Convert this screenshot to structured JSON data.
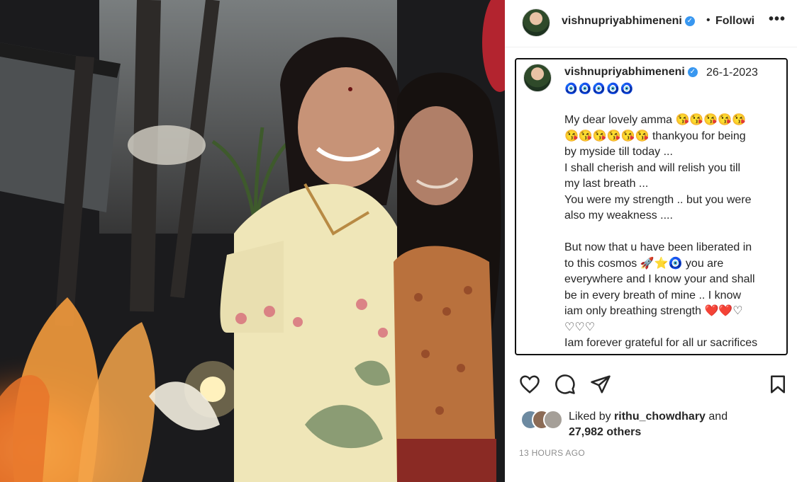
{
  "header": {
    "username": "vishnupriyabhimeneni",
    "separator": "•",
    "follow_label": "Followi",
    "more_label": "•••"
  },
  "caption": {
    "username": "vishnupriyabhimeneni",
    "date": "26-1-2023",
    "emoji_row": "🧿🧿🧿🧿🧿",
    "text": "My dear lovely amma 😘😘😘😘😘\n😘😘😘😘😘😘 thankyou for being\nby myside till today ...\nI shall cherish and will relish you till\nmy last breath ...\nYou were my strength .. but you were\nalso my weakness ....\n\nBut now that u have been liberated in\nto this cosmos 🚀⭐🧿 you are\neverywhere and I know your and shall\nbe in every breath of mine .. I know\niam only breathing strength ❤️❤️♡\n♡♡♡\nIam forever grateful for all ur sacrifices\nand I want you in my next possible"
  },
  "actions": {
    "like_icon": "heart-icon",
    "comment_icon": "comment-icon",
    "share_icon": "share-icon",
    "save_icon": "bookmark-icon"
  },
  "likes": {
    "prefix": "Liked by ",
    "liker_name": "rithu_chowdhary",
    "middle": " and",
    "count": "27,982 others"
  },
  "timestamp": "13 HOURS AGO",
  "colors": {
    "verified": "#3897f0",
    "text": "#262626",
    "muted": "#8e8e8e"
  }
}
